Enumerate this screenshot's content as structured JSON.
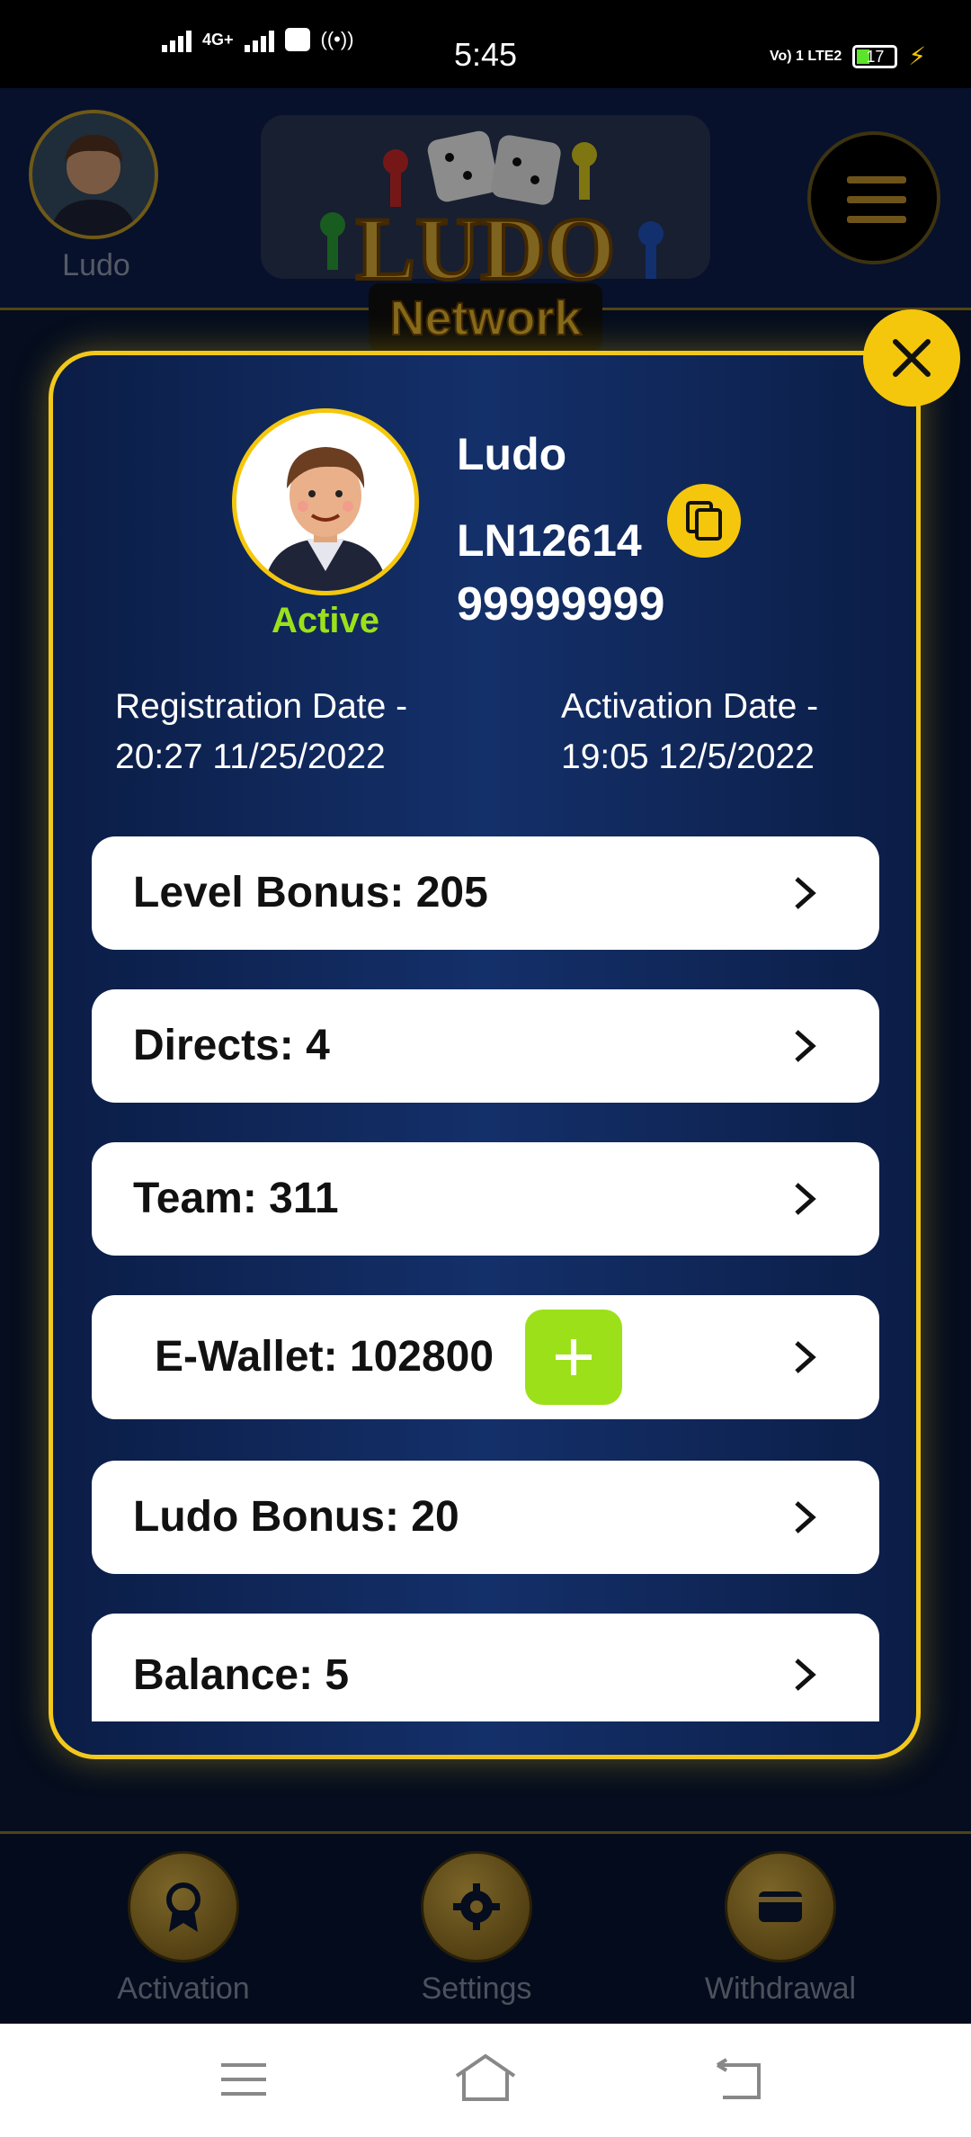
{
  "status_bar": {
    "network": "4G+",
    "time": "5:45",
    "volte": "Vo) 1 LTE2",
    "battery": "17"
  },
  "header": {
    "avatar_label": "Ludo",
    "logo_line1": "LUDO",
    "logo_line2": "Network"
  },
  "profile": {
    "name": "Ludo",
    "id": "LN12614",
    "phone": "99999999",
    "status": "Active",
    "registration_label": "Registration Date -",
    "registration_value": "20:27  11/25/2022",
    "activation_label": "Activation Date -",
    "activation_value": "19:05  12/5/2022"
  },
  "rows": [
    {
      "label": "Level Bonus: 205"
    },
    {
      "label": "Directs: 4"
    },
    {
      "label": "Team: 311"
    },
    {
      "label": "E-Wallet: 102800"
    },
    {
      "label": "Ludo Bonus: 20"
    },
    {
      "label": "Balance: 5"
    }
  ],
  "bottom_nav": [
    {
      "label": "Activation",
      "icon": "award-icon"
    },
    {
      "label": "Settings",
      "icon": "gear-icon"
    },
    {
      "label": "Withdrawal",
      "icon": "wallet-icon"
    }
  ],
  "colors": {
    "accent_gold": "#f5c70c",
    "active_green": "#9be11a",
    "modal_bg": "#0b1d46"
  }
}
